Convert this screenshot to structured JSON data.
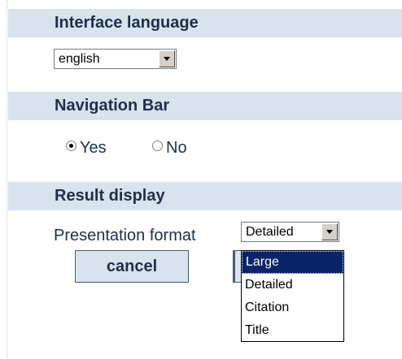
{
  "sections": {
    "language": {
      "title": "Interface language",
      "select_value": "english"
    },
    "navigation": {
      "title": "Navigation Bar",
      "options": [
        {
          "label": "Yes",
          "checked": true
        },
        {
          "label": "No",
          "checked": false
        }
      ]
    },
    "result": {
      "title": "Result display",
      "format_label": "Presentation format",
      "format_value": "Detailed",
      "format_options": [
        "Large",
        "Detailed",
        "Citation",
        "Title"
      ],
      "highlighted_option": "Large"
    }
  },
  "buttons": {
    "cancel_label": "cancel"
  }
}
